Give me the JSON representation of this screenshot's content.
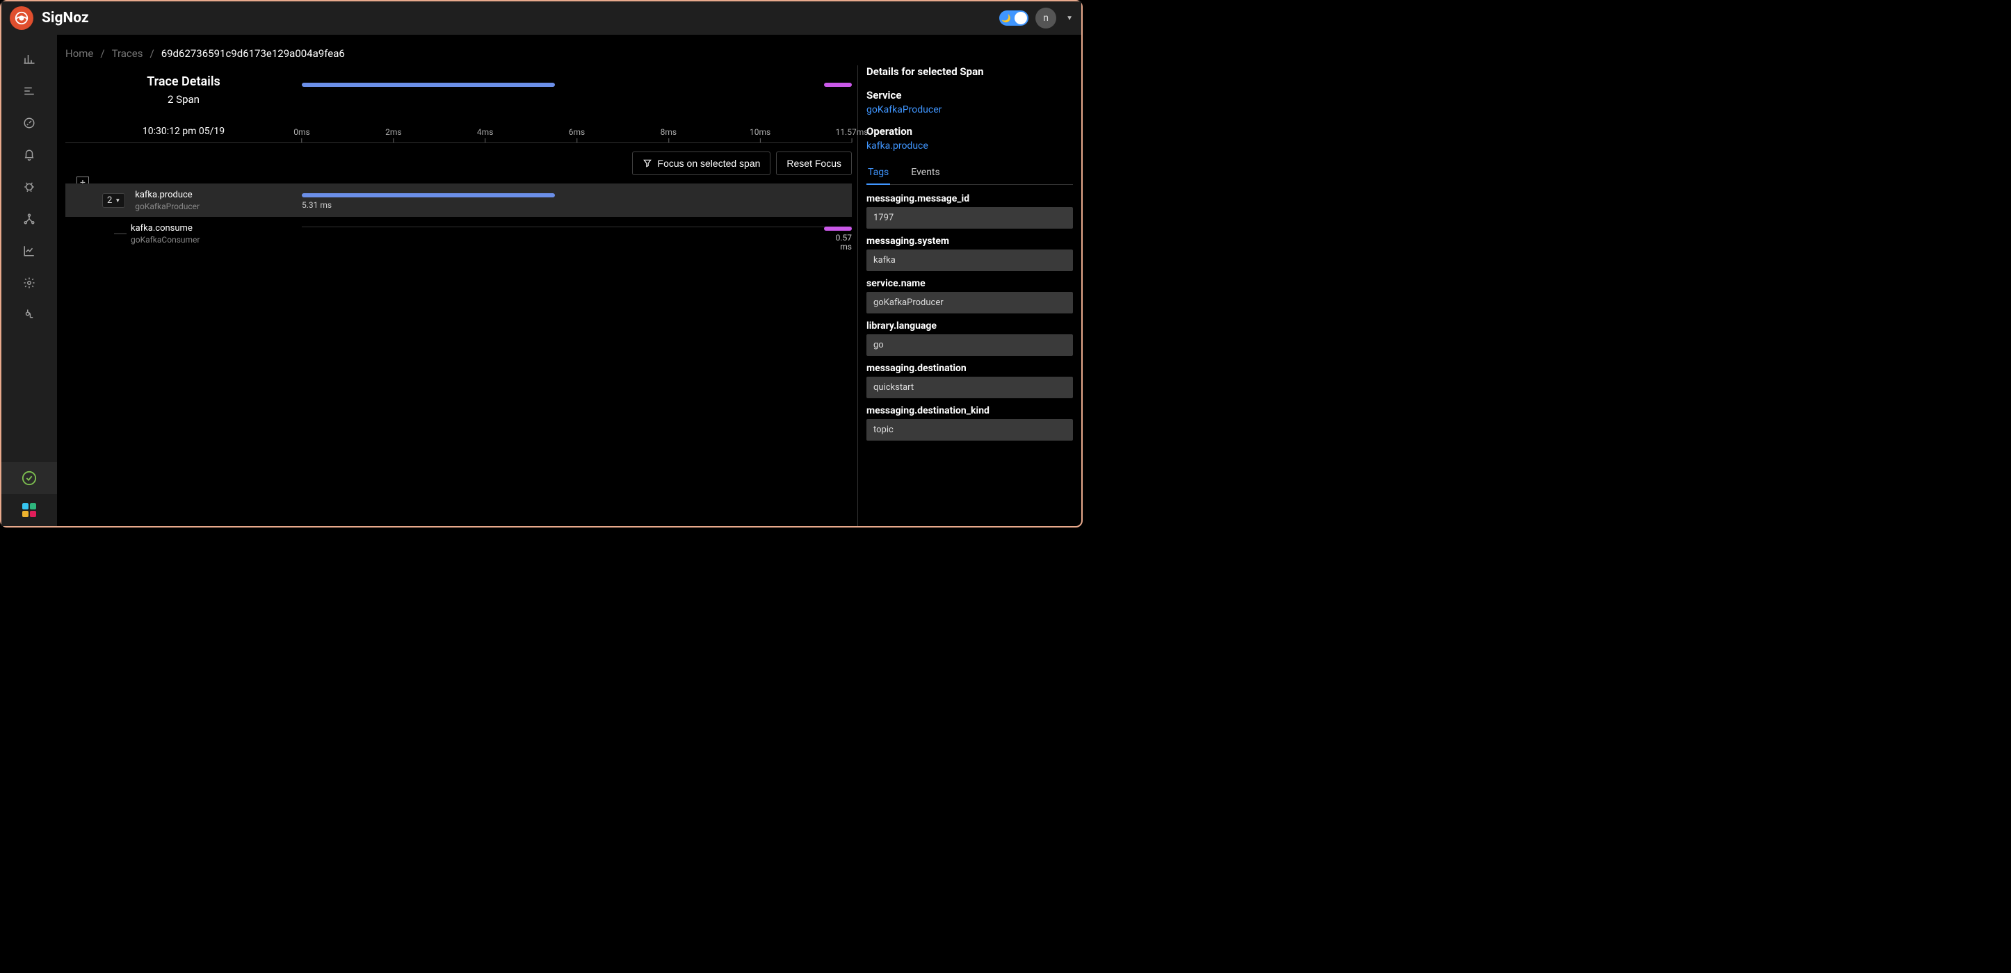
{
  "brand": "SigNoz",
  "user_initial": "n",
  "breadcrumbs": {
    "home": "Home",
    "traces": "Traces",
    "current": "69d62736591c9d6173e129a004a9fea6"
  },
  "trace": {
    "title": "Trace Details",
    "span_count_text": "2 Span",
    "timestamp": "10:30:12 pm 05/19",
    "ticks": [
      "0ms",
      "2ms",
      "4ms",
      "6ms",
      "8ms",
      "10ms",
      "11.57ms"
    ]
  },
  "controls": {
    "focus": "Focus on selected span",
    "reset": "Reset Focus",
    "expand": "+"
  },
  "spans": [
    {
      "count": "2",
      "name": "kafka.produce",
      "service": "goKafkaProducer",
      "duration": "5.31 ms",
      "color": "blue",
      "selected": true
    },
    {
      "name": "kafka.consume",
      "service": "goKafkaConsumer",
      "duration": "0.57 ms",
      "color": "purple",
      "selected": false
    }
  ],
  "details": {
    "header": "Details for selected Span",
    "service_label": "Service",
    "service_value": "goKafkaProducer",
    "operation_label": "Operation",
    "operation_value": "kafka.produce",
    "tabs": {
      "tags": "Tags",
      "events": "Events"
    },
    "tags": [
      {
        "key": "messaging.message_id",
        "value": "1797"
      },
      {
        "key": "messaging.system",
        "value": "kafka"
      },
      {
        "key": "service.name",
        "value": "goKafkaProducer"
      },
      {
        "key": "library.language",
        "value": "go"
      },
      {
        "key": "messaging.destination",
        "value": "quickstart"
      },
      {
        "key": "messaging.destination_kind",
        "value": "topic"
      }
    ]
  }
}
